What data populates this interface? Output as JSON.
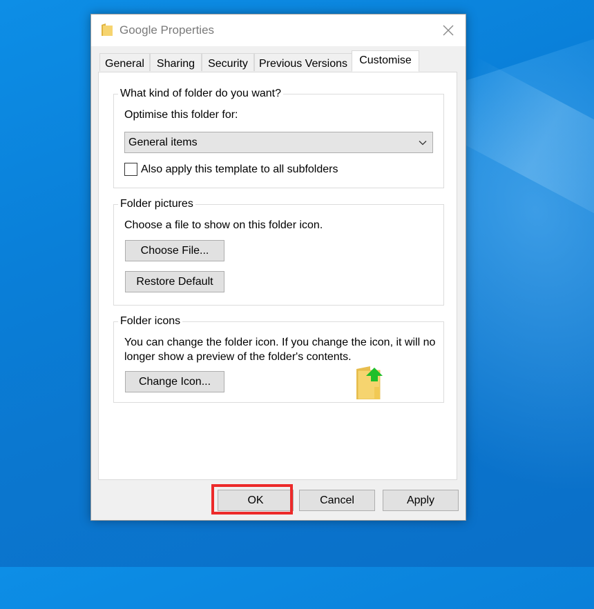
{
  "window": {
    "title": "Google Properties"
  },
  "tabs": [
    {
      "label": "General"
    },
    {
      "label": "Sharing"
    },
    {
      "label": "Security"
    },
    {
      "label": "Previous Versions"
    },
    {
      "label": "Customise"
    }
  ],
  "active_tab": "Customise",
  "folder_type": {
    "group_label": "What kind of folder do you want?",
    "optimise_label": "Optimise this folder for:",
    "selected_value": "General items",
    "apply_subfolders_label": "Also apply this template to all subfolders",
    "apply_subfolders_checked": false
  },
  "folder_pictures": {
    "group_label": "Folder pictures",
    "description": "Choose a file to show on this folder icon.",
    "choose_file_label": "Choose File...",
    "restore_default_label": "Restore Default"
  },
  "folder_icons": {
    "group_label": "Folder icons",
    "description_line1": "You can change the folder icon. If you change the icon, it will no",
    "description_line2": "longer show a preview of the folder's contents.",
    "change_icon_label": "Change Icon..."
  },
  "footer": {
    "ok_label": "OK",
    "cancel_label": "Cancel",
    "apply_label": "Apply"
  },
  "colors": {
    "desktop": "#0a7fd8",
    "highlight": "#ec2a2a",
    "arrow": "#1fbf2a",
    "folder": "#f4cf6a"
  },
  "icons": {
    "title": "folder-icon",
    "close": "close-icon",
    "dropdown": "chevron-down-icon",
    "preview": "folder-with-arrow-icon"
  }
}
